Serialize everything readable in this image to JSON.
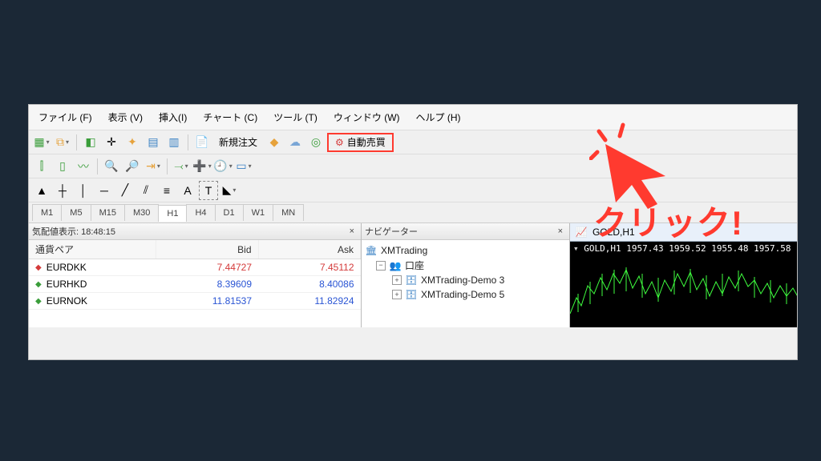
{
  "menu": {
    "file": "ファイル (F)",
    "view": "表示 (V)",
    "insert": "挿入(I)",
    "chart": "チャート (C)",
    "tools": "ツール (T)",
    "window": "ウィンドウ (W)",
    "help": "ヘルプ (H)"
  },
  "toolbar1": {
    "new_order": "新規注文",
    "autotrade": "自動売買"
  },
  "timeframes": {
    "m1": "M1",
    "m5": "M5",
    "m15": "M15",
    "m30": "M30",
    "h1": "H1",
    "h4": "H4",
    "d1": "D1",
    "w1": "W1",
    "mn": "MN"
  },
  "marketwatch": {
    "title": "気配値表示: 18:48:15",
    "col_symbol": "通貨ペア",
    "col_bid": "Bid",
    "col_ask": "Ask",
    "rows": [
      {
        "dir": "down",
        "symbol": "EURDKK",
        "bid": "7.44727",
        "ask": "7.45112",
        "color": "red"
      },
      {
        "dir": "up",
        "symbol": "EURHKD",
        "bid": "8.39609",
        "ask": "8.40086",
        "color": "blue"
      },
      {
        "dir": "up",
        "symbol": "EURNOK",
        "bid": "11.81537",
        "ask": "11.82924",
        "color": "blue"
      }
    ]
  },
  "navigator": {
    "title": "ナビゲーター",
    "root": "XMTrading",
    "accounts_label": "口座",
    "items": [
      "XMTrading-Demo 3",
      "XMTrading-Demo 5"
    ]
  },
  "chart": {
    "title": "GOLD,H1",
    "info": "GOLD,H1 1957.43 1959.52 1955.48 1957.58"
  },
  "annotation": {
    "click": "クリック!"
  }
}
